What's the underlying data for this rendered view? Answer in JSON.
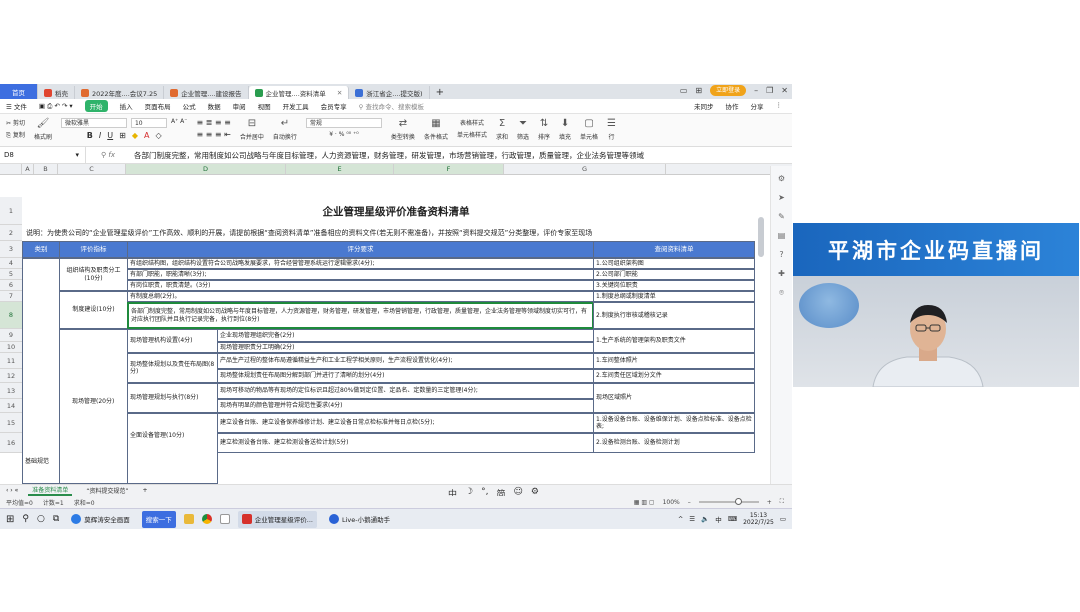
{
  "tabs": [
    {
      "label": "首页",
      "icon": "home-icon"
    },
    {
      "label": "稻壳",
      "icon": "docer-icon",
      "color": "#e0452f"
    },
    {
      "label": "2022年度....会议7.25",
      "icon": "ppt-icon",
      "color": "#e06a2f"
    },
    {
      "label": "企业管理....建设报告",
      "icon": "ppt-icon",
      "color": "#e06a2f"
    },
    {
      "label": "企业管理....资料清单",
      "icon": "sheet-icon",
      "color": "#2a9d4f"
    },
    {
      "label": "浙江省企....提交版)",
      "icon": "doc-icon",
      "color": "#3b6fd6"
    }
  ],
  "login_label": "立即登录",
  "menu": {
    "file": "文件",
    "items": [
      "开始",
      "插入",
      "页面布局",
      "公式",
      "数据",
      "审阅",
      "视图",
      "开发工具",
      "会员专享"
    ],
    "search": "查找命令、搜索模板",
    "right": [
      "未同步",
      "协作",
      "分享"
    ]
  },
  "ribbon": {
    "cut": "剪切",
    "copy": "复制",
    "format_painter": "格式刷",
    "paste": "粘贴",
    "font": "微软雅黑",
    "size": "10",
    "merge": "合并居中",
    "wrap": "自动换行",
    "number_format": "常规",
    "convert": "类型转换",
    "cond_format": "条件格式",
    "table_style": "表格样式",
    "cell_style": "单元格样式",
    "sum": "求和",
    "filter": "筛选",
    "sort": "排序",
    "fill": "填充",
    "cell": "单元格",
    "row": "行"
  },
  "formula": {
    "cell_ref": "D8",
    "fx": "fx",
    "content": "各部门制度完整，常用制度如公司战略与年度目标管理，人力资源管理，财务管理，研发管理，市场营销管理，行政管理，质量管理，企业法务管理等领域"
  },
  "columns": [
    "A",
    "B",
    "C",
    "D",
    "E",
    "F",
    "G"
  ],
  "sheet": {
    "title": "企业管理星级评价准备资料清单",
    "note": "说明：为使贵公司的“企业管理星级评价”工作高效、顺利的开展，请提前根据“查阅资料清单”准备相应的资料文件(若无则不需准备)，并按照“资料提交规范”分类整理，评价专家至现场",
    "headers": [
      "类别",
      "评价指标",
      "评分要求",
      "查阅资料清单"
    ],
    "rows": {
      "r4_5": "组织结构及职责分工(10分)",
      "r4": "有组织结构图，组织结构设置符合公司战略发展要求，符合经营管理系统运行逻辑需求(4分);",
      "r5": "有部门职能，职能清晰(3分);",
      "r6": "有岗位职责，职责清楚。(3分)",
      "g4": "1.公司组织架构图",
      "g5": "2.公司部门职能",
      "g6": "3.关键岗位职责",
      "r7_8": "制度建设(10分)",
      "r7": "有制度总纲(2分)。",
      "r8": "各部门制度完整，常用制度如公司战略与年度目标管理，人力资源管理，财务管理，研发管理，市场营销管理，行政管理，质量管理，企业法务管理等领域制度切实可行，有对应执行团队并且执行记录完备，执行到位(8分)",
      "g7": "1.制度总纲或制度清单",
      "g8": "2.制度执行审核或稽核记录",
      "r9_10": "现场管理机构设置(4分)",
      "r9": "企业现场管理组织完备(2分)",
      "r10": "现场管理职责分工明确(2分)",
      "g9_10": "1.生产系统的管理架构及职责文件",
      "r11_12": "现场整体规划以及责任布局图(8分)",
      "r11": "产品生产过程的整体布局遵循精益生产和工业工程学相关原则，生产流程设置优化(4分);",
      "r12": "现场整体规划责任布局图分解到部门并进行了清晰的划分(4分)",
      "g11": "1.车间整体照片",
      "g12": "2.车间责任区域划分文件",
      "r13_14": "现场管理规划与执行(8分)",
      "r13": "现场可移动的物品等有现场的定位标识且超过80%做到定位置、定品名、定数量的三定管理(4分);",
      "r14": "现场有明显的颜色管理并符合规范性要求(4分)",
      "g13_14": "现场区域照片",
      "b_group": "现场管理(20分)",
      "r15_16": "全面设备管理(10分)",
      "r15": "建立设备台账、建立设备保养维修计划、建立设备日常点检标准并每日点检(5分);",
      "r16": "建立检测设备台账、建立检测设备送检计划(5分)",
      "g15": "1.设备设备台账、设备维保计划、设备点检标准、设备点检表;",
      "g16": "2.设备检测台账、设备检测计划",
      "a_group": "基础规范"
    }
  },
  "sheet_tabs": [
    "准备资料清单",
    "“资料提交规范”"
  ],
  "status": {
    "avg": "平均值=0",
    "count": "计数=1",
    "sum": "求和=0",
    "zoom": "100%"
  },
  "ime": [
    "中",
    "简"
  ],
  "taskbar": {
    "items": [
      "莫辉涛安全画面",
      "搜索一下",
      "企业管理星级评价...",
      "Live-小鹅通助手"
    ],
    "time": "15:13",
    "date": "2022/7/25",
    "tray_lang": "中"
  },
  "video": {
    "banner": "平湖市企业码直播间"
  }
}
